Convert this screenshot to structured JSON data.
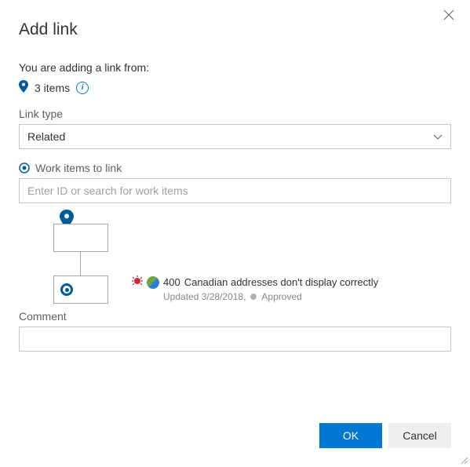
{
  "dialog": {
    "title": "Add link",
    "subtitle": "You are adding a link from:",
    "items_count": "3 items"
  },
  "link_type": {
    "label": "Link type",
    "selected": "Related"
  },
  "work_items": {
    "label": "Work items to link",
    "placeholder": "Enter ID or search for work items"
  },
  "selected_item": {
    "id": "400",
    "title": "Canadian addresses don't display correctly",
    "updated": "Updated 3/28/2018,",
    "state": "Approved"
  },
  "comment": {
    "label": "Comment",
    "value": ""
  },
  "buttons": {
    "ok": "OK",
    "cancel": "Cancel"
  }
}
